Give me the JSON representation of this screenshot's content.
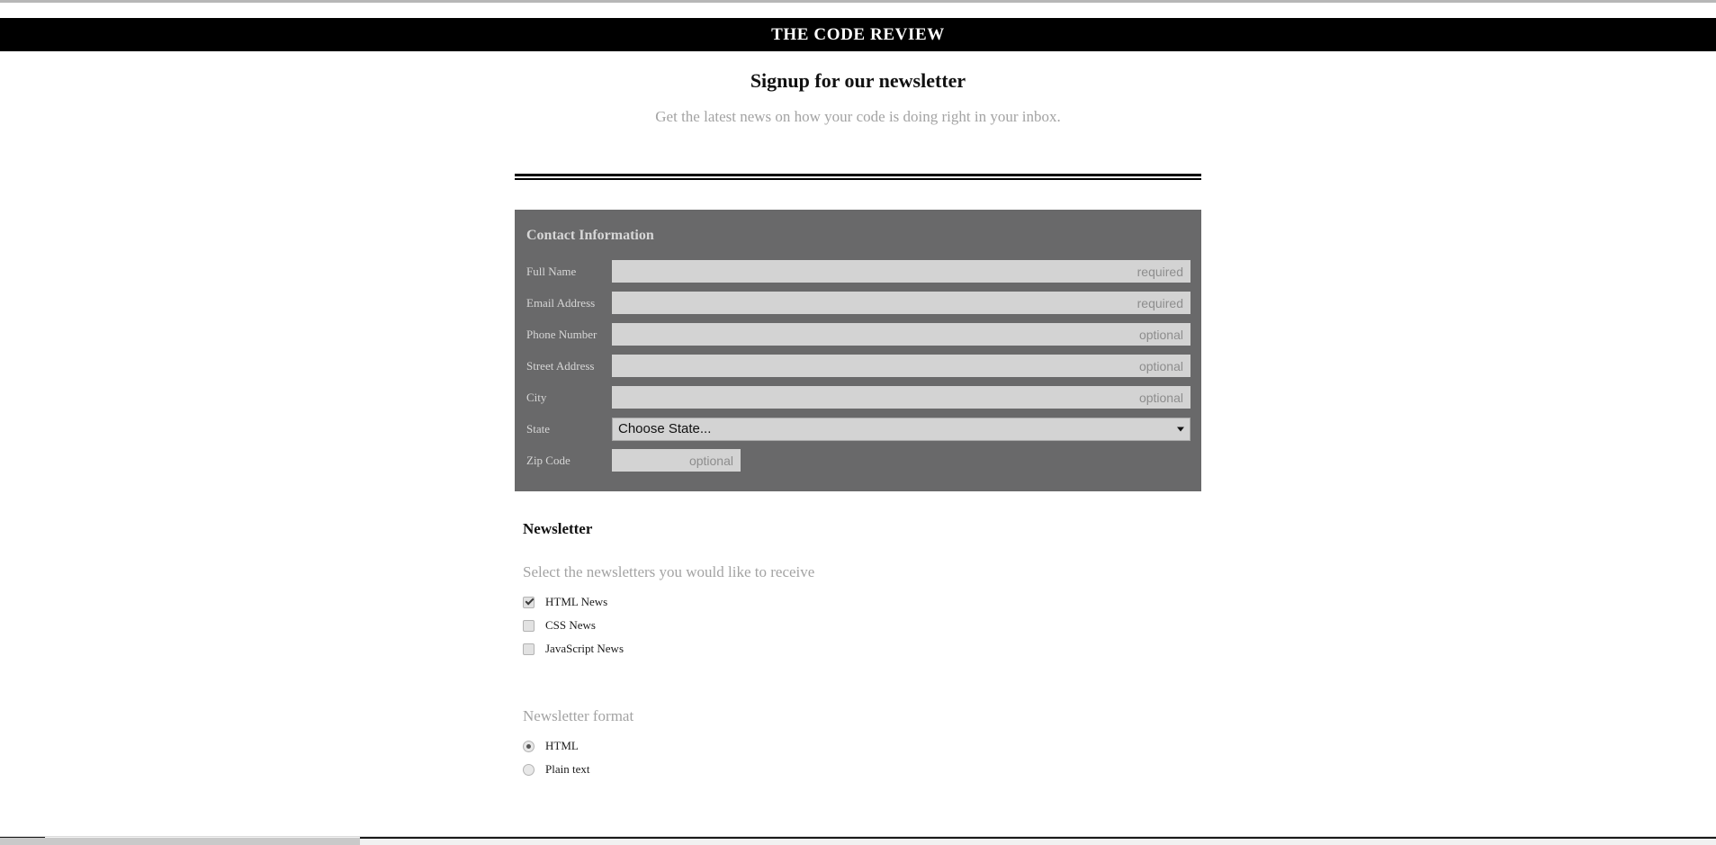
{
  "site": {
    "masthead_title": "THE CODE REVIEW"
  },
  "intro": {
    "heading": "Signup for our newsletter",
    "subheading": "Get the latest news on how your code is doing right in your inbox."
  },
  "contact": {
    "legend": "Contact Information",
    "fields": [
      {
        "label": "Full Name",
        "placeholder": "required",
        "value": "",
        "type": "text",
        "width": "full"
      },
      {
        "label": "Email Address",
        "placeholder": "required",
        "value": "",
        "type": "text",
        "width": "full"
      },
      {
        "label": "Phone Number",
        "placeholder": "optional",
        "value": "",
        "type": "text",
        "width": "full"
      },
      {
        "label": "Street Address",
        "placeholder": "optional",
        "value": "",
        "type": "text",
        "width": "full"
      },
      {
        "label": "City",
        "placeholder": "optional",
        "value": "",
        "type": "text",
        "width": "full"
      }
    ],
    "state": {
      "label": "State",
      "selected": "Choose State...",
      "options": [
        "Choose State..."
      ]
    },
    "zip": {
      "label": "Zip Code",
      "placeholder": "optional",
      "value": ""
    }
  },
  "newsletter": {
    "heading": "Newsletter",
    "select_legend": "Select the newsletters you would like to receive",
    "checkboxes": [
      {
        "label": "HTML News",
        "checked": true
      },
      {
        "label": "CSS News",
        "checked": false
      },
      {
        "label": "JavaScript News",
        "checked": false
      }
    ],
    "format_legend": "Newsletter format",
    "radios": [
      {
        "label": "HTML",
        "checked": true
      },
      {
        "label": "Plain text",
        "checked": false
      }
    ]
  },
  "colors": {
    "masthead_bg": "#000000",
    "panel_bg": "#69696a",
    "input_bg": "#d3d3d3",
    "muted_text": "#a3a3a3",
    "label_text": "#d6d6d6"
  }
}
